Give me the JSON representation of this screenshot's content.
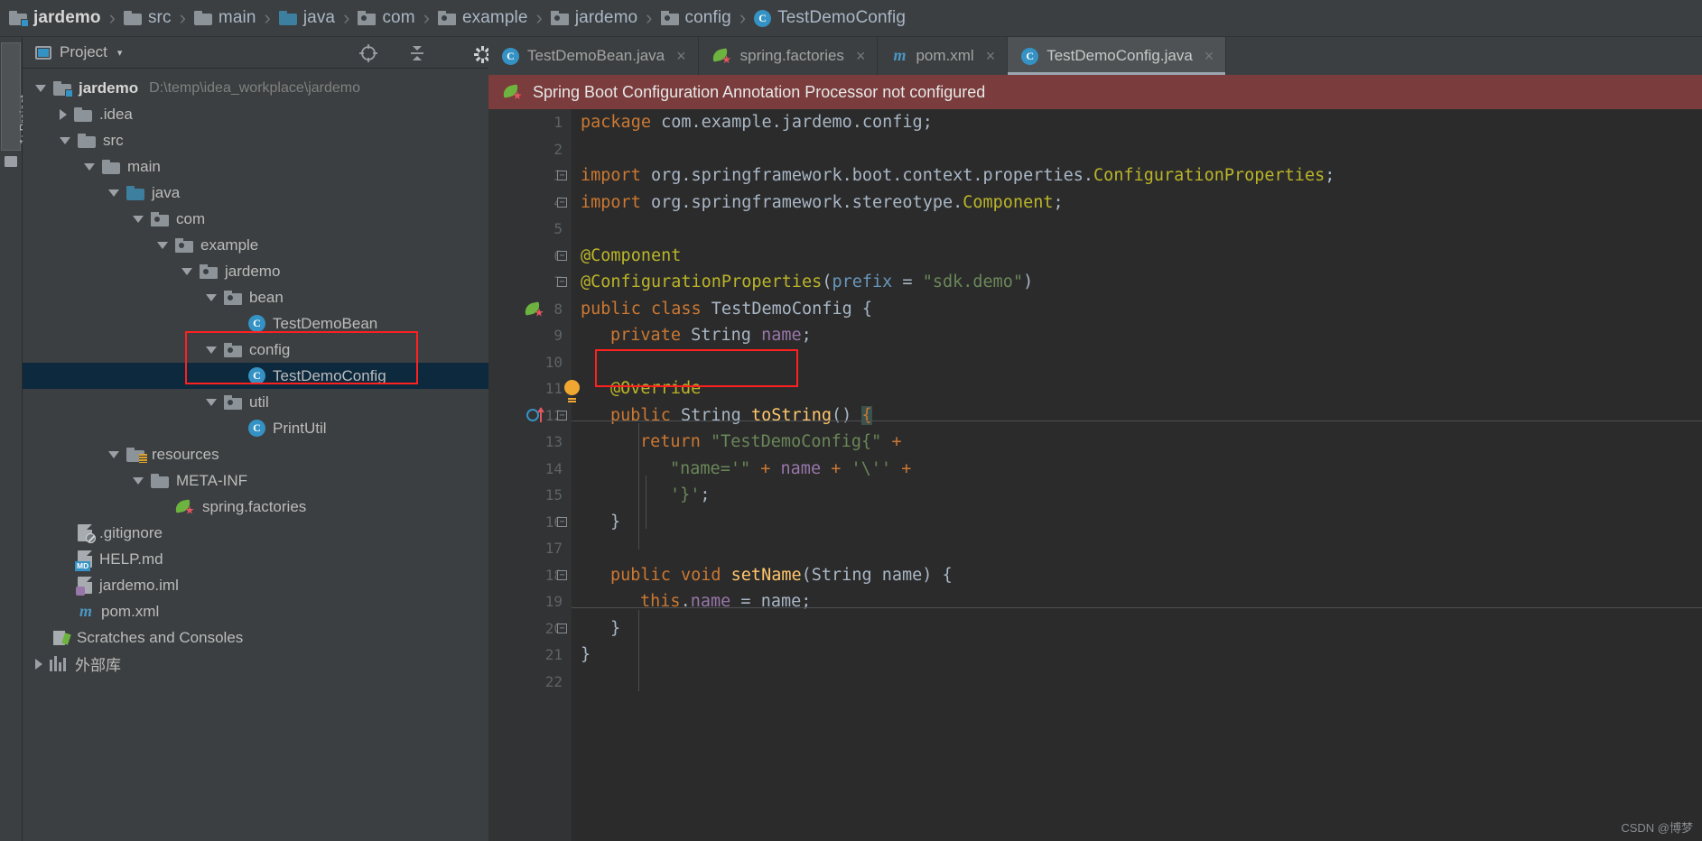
{
  "breadcrumb": [
    {
      "label": "jardemo",
      "icon": "module-folder-icon"
    },
    {
      "label": "src",
      "icon": "folder-icon"
    },
    {
      "label": "main",
      "icon": "folder-icon"
    },
    {
      "label": "java",
      "icon": "source-folder-icon"
    },
    {
      "label": "com",
      "icon": "package-icon"
    },
    {
      "label": "example",
      "icon": "package-icon"
    },
    {
      "label": "jardemo",
      "icon": "package-icon"
    },
    {
      "label": "config",
      "icon": "package-icon"
    },
    {
      "label": "TestDemoConfig",
      "icon": "java-class-icon"
    }
  ],
  "separator": "›",
  "tool_stripe": {
    "project_tab": "1: Project"
  },
  "project_panel": {
    "title": "Project",
    "caret": "▾",
    "toolbar_icons": [
      "panel-view-icon",
      "locate-icon",
      "collapse-all-icon",
      "settings-gear-icon",
      "hide-panel-icon"
    ],
    "tree": [
      {
        "label": "jardemo",
        "path": "D:\\temp\\idea_workplace\\jardemo",
        "indent": 0,
        "arrow": "down",
        "icon": "module-folder-icon",
        "bold": true
      },
      {
        "label": ".idea",
        "indent": 1,
        "arrow": "right",
        "icon": "folder-icon"
      },
      {
        "label": "src",
        "indent": 1,
        "arrow": "down",
        "icon": "folder-icon"
      },
      {
        "label": "main",
        "indent": 2,
        "arrow": "down",
        "icon": "folder-icon"
      },
      {
        "label": "java",
        "indent": 3,
        "arrow": "down",
        "icon": "source-folder-icon"
      },
      {
        "label": "com",
        "indent": 4,
        "arrow": "down",
        "icon": "package-icon"
      },
      {
        "label": "example",
        "indent": 5,
        "arrow": "down",
        "icon": "package-icon"
      },
      {
        "label": "jardemo",
        "indent": 6,
        "arrow": "down",
        "icon": "package-icon"
      },
      {
        "label": "bean",
        "indent": 7,
        "arrow": "down",
        "icon": "package-icon"
      },
      {
        "label": "TestDemoBean",
        "indent": 8,
        "arrow": "none",
        "icon": "java-class-icon"
      },
      {
        "label": "config",
        "indent": 7,
        "arrow": "down",
        "icon": "package-icon"
      },
      {
        "label": "TestDemoConfig",
        "indent": 8,
        "arrow": "none",
        "icon": "java-class-icon",
        "selected": true
      },
      {
        "label": "util",
        "indent": 7,
        "arrow": "down",
        "icon": "package-icon"
      },
      {
        "label": "PrintUtil",
        "indent": 8,
        "arrow": "none",
        "icon": "java-class-icon"
      },
      {
        "label": "resources",
        "indent": 3,
        "arrow": "down",
        "icon": "resources-folder-icon"
      },
      {
        "label": "META-INF",
        "indent": 4,
        "arrow": "down",
        "icon": "folder-icon"
      },
      {
        "label": "spring.factories",
        "indent": 5,
        "arrow": "none",
        "icon": "spring-leaf-icon"
      },
      {
        "label": ".gitignore",
        "indent": 1,
        "arrow": "none",
        "icon": "gitignore-file-icon"
      },
      {
        "label": "HELP.md",
        "indent": 1,
        "arrow": "none",
        "icon": "markdown-file-icon"
      },
      {
        "label": "jardemo.iml",
        "indent": 1,
        "arrow": "none",
        "icon": "iml-file-icon"
      },
      {
        "label": "pom.xml",
        "indent": 1,
        "arrow": "none",
        "icon": "maven-file-icon"
      },
      {
        "label": "Scratches and Consoles",
        "indent": 0,
        "arrow": "none",
        "icon": "scratches-icon"
      },
      {
        "label": "外部库",
        "indent": 0,
        "arrow": "right",
        "icon": "external-libraries-icon"
      }
    ]
  },
  "editor": {
    "tabs": [
      {
        "label": "TestDemoBean.java",
        "icon": "java-class-icon",
        "active": false,
        "close": "×"
      },
      {
        "label": "spring.factories",
        "icon": "spring-leaf-icon",
        "active": false,
        "close": "×"
      },
      {
        "label": "pom.xml",
        "icon": "maven-file-icon",
        "active": false,
        "close": "×"
      },
      {
        "label": "TestDemoConfig.java",
        "icon": "java-class-icon",
        "active": true,
        "close": "×"
      }
    ],
    "warning_banner": {
      "text": "Spring Boot Configuration Annotation Processor not configured",
      "icon": "spring-leaf-icon",
      "bg_color": "#7a3c3c"
    },
    "line_numbers": [
      "1",
      "2",
      "3",
      "4",
      "5",
      "6",
      "7",
      "8",
      "9",
      "10",
      "11",
      "12",
      "13",
      "14",
      "15",
      "16",
      "17",
      "18",
      "19",
      "20",
      "21",
      "22"
    ],
    "code_lines": [
      {
        "n": 1,
        "tokens": [
          {
            "t": "package ",
            "c": "kw"
          },
          {
            "t": "com.example.jardemo.config;",
            "c": "pl"
          }
        ]
      },
      {
        "n": 2,
        "tokens": []
      },
      {
        "n": 3,
        "fold": true,
        "tokens": [
          {
            "t": "import ",
            "c": "kw"
          },
          {
            "t": "org.springframework.boot.context.properties.",
            "c": "pl"
          },
          {
            "t": "ConfigurationProperties",
            "c": "ann"
          },
          {
            "t": ";",
            "c": "pl"
          }
        ]
      },
      {
        "n": 4,
        "fold": true,
        "tokens": [
          {
            "t": "import ",
            "c": "kw"
          },
          {
            "t": "org.springframework.stereotype.",
            "c": "pl"
          },
          {
            "t": "Component",
            "c": "ann"
          },
          {
            "t": ";",
            "c": "pl"
          }
        ]
      },
      {
        "n": 5,
        "tokens": []
      },
      {
        "n": 6,
        "fold": true,
        "tokens": [
          {
            "t": "@Component",
            "c": "ann"
          }
        ]
      },
      {
        "n": 7,
        "fold": true,
        "tokens": [
          {
            "t": "@ConfigurationProperties",
            "c": "ann"
          },
          {
            "t": "(",
            "c": "pl"
          },
          {
            "t": "prefix",
            "c": "num"
          },
          {
            "t": " = ",
            "c": "pl"
          },
          {
            "t": "\"sdk.demo\"",
            "c": "str"
          },
          {
            "t": ")",
            "c": "pl"
          }
        ]
      },
      {
        "n": 8,
        "gutter_icon": "spring-bean-icon",
        "tokens": [
          {
            "t": "public class ",
            "c": "kw"
          },
          {
            "t": "TestDemoConfig ",
            "c": "pl"
          },
          {
            "t": "{",
            "c": "pl"
          }
        ]
      },
      {
        "n": 9,
        "indent": 1,
        "tokens": [
          {
            "t": "private ",
            "c": "kw"
          },
          {
            "t": "String ",
            "c": "type"
          },
          {
            "t": "name",
            "c": "field"
          },
          {
            "t": ";",
            "c": "pl"
          }
        ]
      },
      {
        "n": 10,
        "tokens": []
      },
      {
        "n": 11,
        "indent": 1,
        "gutter_icon": "lightbulb-icon",
        "tokens": [
          {
            "t": "@Override",
            "c": "ann"
          }
        ]
      },
      {
        "n": 12,
        "indent": 1,
        "fold": true,
        "gutter_icon": "override-method-icon",
        "tokens": [
          {
            "t": "public ",
            "c": "kw"
          },
          {
            "t": "String ",
            "c": "type"
          },
          {
            "t": "toString",
            "c": "cls"
          },
          {
            "t": "() ",
            "c": "pl"
          },
          {
            "t": "{",
            "c": "brace"
          }
        ]
      },
      {
        "n": 13,
        "indent": 2,
        "tokens": [
          {
            "t": "return ",
            "c": "kw"
          },
          {
            "t": "\"TestDemoConfig{\"",
            "c": "str"
          },
          {
            "t": " + ",
            "c": "kw"
          }
        ]
      },
      {
        "n": 14,
        "indent": 3,
        "tokens": [
          {
            "t": "\"name='\"",
            "c": "str"
          },
          {
            "t": " + ",
            "c": "kw"
          },
          {
            "t": "name",
            "c": "field"
          },
          {
            "t": " + ",
            "c": "kw"
          },
          {
            "t": "'\\''",
            "c": "str"
          },
          {
            "t": " +",
            "c": "kw"
          }
        ]
      },
      {
        "n": 15,
        "indent": 3,
        "tokens": [
          {
            "t": "'}'",
            "c": "str"
          },
          {
            "t": ";",
            "c": "pl"
          }
        ]
      },
      {
        "n": 16,
        "indent": 1,
        "fold": true,
        "tokens": [
          {
            "t": "}",
            "c": "pl"
          }
        ]
      },
      {
        "n": 17,
        "tokens": []
      },
      {
        "n": 18,
        "indent": 1,
        "fold": true,
        "tokens": [
          {
            "t": "public void ",
            "c": "kw"
          },
          {
            "t": "setName",
            "c": "cls"
          },
          {
            "t": "(",
            "c": "pl"
          },
          {
            "t": "String ",
            "c": "type"
          },
          {
            "t": "name",
            "c": "param"
          },
          {
            "t": ") ",
            "c": "pl"
          },
          {
            "t": "{",
            "c": "pl"
          }
        ]
      },
      {
        "n": 19,
        "indent": 2,
        "tokens": [
          {
            "t": "this",
            "c": "kw"
          },
          {
            "t": ".",
            "c": "pl"
          },
          {
            "t": "name",
            "c": "field"
          },
          {
            "t": " = ",
            "c": "pl"
          },
          {
            "t": "name",
            "c": "pl"
          },
          {
            "t": ";",
            "c": "pl"
          }
        ]
      },
      {
        "n": 20,
        "indent": 1,
        "fold": true,
        "tokens": [
          {
            "t": "}",
            "c": "pl"
          }
        ]
      },
      {
        "n": 21,
        "tokens": [
          {
            "t": "}",
            "c": "pl"
          }
        ]
      },
      {
        "n": 22,
        "tokens": []
      }
    ]
  },
  "annotations": {
    "tree_highlight_label": "config / TestDemoConfig highlight",
    "code_highlight_label": "private String name; highlight",
    "box_color": "#ff2020"
  },
  "watermark": "CSDN @博梦",
  "colors": {
    "keyword": "#cc7832",
    "annotation": "#bbb529",
    "string": "#6a8759",
    "field": "#9876aa",
    "method": "#ffc66d",
    "plain": "#a9b7c6",
    "editor_bg": "#2b2b2b",
    "panel_bg": "#3c3f41",
    "selection_bg": "#0d293e",
    "warning_bg": "#7a3c3c",
    "accent_blue": "#3592c4",
    "spring_green": "#6db33f"
  }
}
